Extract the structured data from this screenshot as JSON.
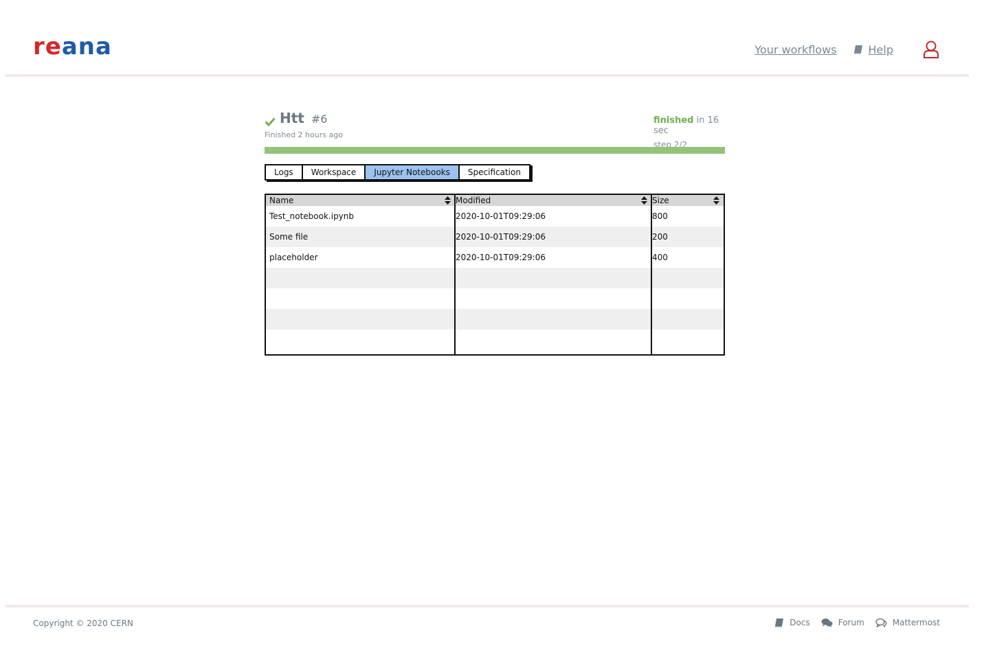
{
  "header": {
    "logo_part1": "re",
    "logo_part2": "ana",
    "nav": {
      "workflows_label": "Your workflows",
      "help_label": "Help"
    }
  },
  "workflow": {
    "name": "Htt",
    "run": "#6",
    "finished_ago": "Finished 2 hours ago",
    "status": "finished",
    "duration": "in 16 sec",
    "step": "step 2/2",
    "progress": 1.0
  },
  "tabs": [
    {
      "label": "Logs",
      "active": false
    },
    {
      "label": "Workspace",
      "active": false
    },
    {
      "label": "Jupyter Notebooks",
      "active": true
    },
    {
      "label": "Specification",
      "active": false
    }
  ],
  "table": {
    "columns": [
      "Name",
      "Modified",
      "Size"
    ],
    "rows": [
      [
        "Test_notebook.ipynb",
        "2020-10-01T09:29:06",
        "800"
      ],
      [
        "Some file",
        "2020-10-01T09:29:06",
        "200"
      ],
      [
        "placeholder",
        "2020-10-01T09:29:06",
        "400"
      ],
      [
        "",
        "",
        ""
      ],
      [
        "",
        "",
        ""
      ],
      [
        "",
        "",
        ""
      ],
      [
        "",
        "",
        ""
      ]
    ]
  },
  "footer": {
    "copyright": "Copyright © 2020 CERN",
    "links": [
      "Docs",
      "Forum",
      "Mattermost"
    ]
  },
  "colors": {
    "logo_red": "#d4272a",
    "logo_blue": "#1f5ba8",
    "status_green": "#6fae4e",
    "progress_fill": "#94c27a",
    "tab_active": "#9cc3f0"
  },
  "icons": {
    "help": "book-icon",
    "user": "user-icon",
    "status": "check-icon",
    "docs": "book-icon",
    "forum": "chat-bubbles-icon",
    "mattermost": "chat-outline-icon",
    "sort": "sort-icon"
  }
}
